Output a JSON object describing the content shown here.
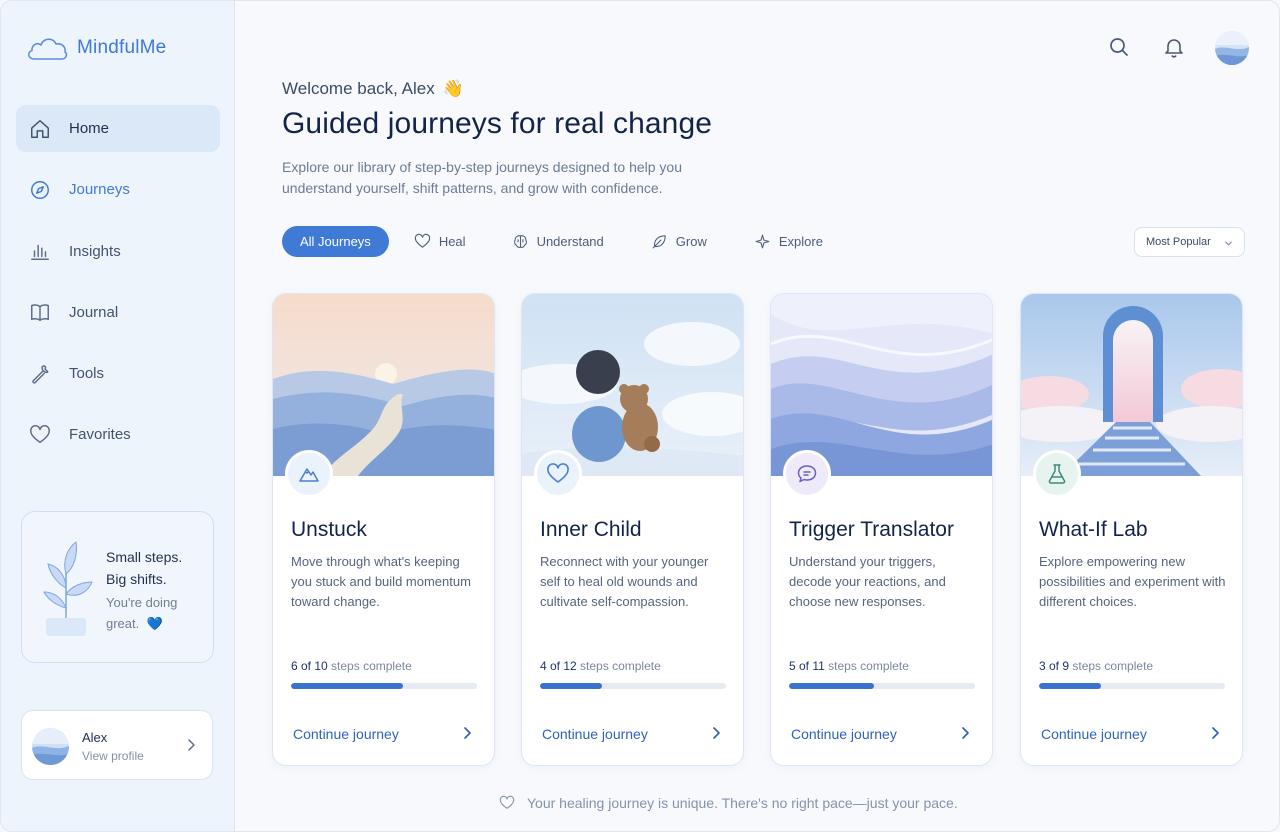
{
  "brand": {
    "name": "MindfulMe",
    "icon": "cloud-icon"
  },
  "nav": [
    {
      "label": "Home",
      "icon": "home-icon",
      "active": true
    },
    {
      "label": "Journeys",
      "icon": "compass-icon",
      "accent": true
    },
    {
      "label": "Insights",
      "icon": "bar-chart-icon"
    },
    {
      "label": "Journal",
      "icon": "book-icon"
    },
    {
      "label": "Tools",
      "icon": "wrench-icon"
    },
    {
      "label": "Favorites",
      "icon": "heart-icon"
    }
  ],
  "promo": {
    "title_line1": "Small steps.",
    "title_line2": "Big shifts.",
    "sub_line1": "You're doing",
    "sub_line2": "great.",
    "heart": "💙"
  },
  "profile": {
    "name": "Alex",
    "sub": "View profile"
  },
  "header": {
    "welcome": "Welcome back, Alex",
    "wave": "👋",
    "title": "Guided journeys for real change",
    "description": "Explore our library of step-by-step journeys designed to help you understand yourself, shift patterns, and grow with confidence."
  },
  "filters": [
    {
      "label": "All Journeys",
      "active": true
    },
    {
      "label": "Heal",
      "icon": "heart-icon"
    },
    {
      "label": "Understand",
      "icon": "brain-icon"
    },
    {
      "label": "Grow",
      "icon": "leaf-icon"
    },
    {
      "label": "Explore",
      "icon": "sparkle-icon"
    }
  ],
  "sort": {
    "label": "Most Popular"
  },
  "cards": [
    {
      "title": "Unstuck",
      "description": "Move through what's keeping you stuck and build momentum toward change.",
      "done": "6 of 10",
      "steps_label": "steps complete",
      "progress": 0.6,
      "cta": "Continue journey",
      "icon": "mountain-icon"
    },
    {
      "title": "Inner Child",
      "description": "Reconnect with your younger self to heal old wounds and cultivate self-compassion.",
      "done": "4 of 12",
      "steps_label": "steps complete",
      "progress": 0.3333,
      "cta": "Continue journey",
      "icon": "heart-icon"
    },
    {
      "title": "Trigger Translator",
      "description": "Understand your triggers, decode your reactions, and choose new responses.",
      "done": "5 of 11",
      "steps_label": "steps complete",
      "progress": 0.4545,
      "cta": "Continue journey",
      "icon": "chat-bubble-icon"
    },
    {
      "title": "What-If Lab",
      "description": "Explore empowering new possibilities and experiment with different choices.",
      "done": "3 of 9",
      "steps_label": "steps complete",
      "progress": 0.3333,
      "cta": "Continue journey",
      "icon": "flask-icon"
    }
  ],
  "footer": {
    "note": "Your healing journey is unique. There's no right pace—just your pace."
  },
  "colors": {
    "accent": "#3f7ad6",
    "progress": "#3b72d0",
    "title": "#13244a",
    "sidebar_bg": "#eef4fb"
  }
}
